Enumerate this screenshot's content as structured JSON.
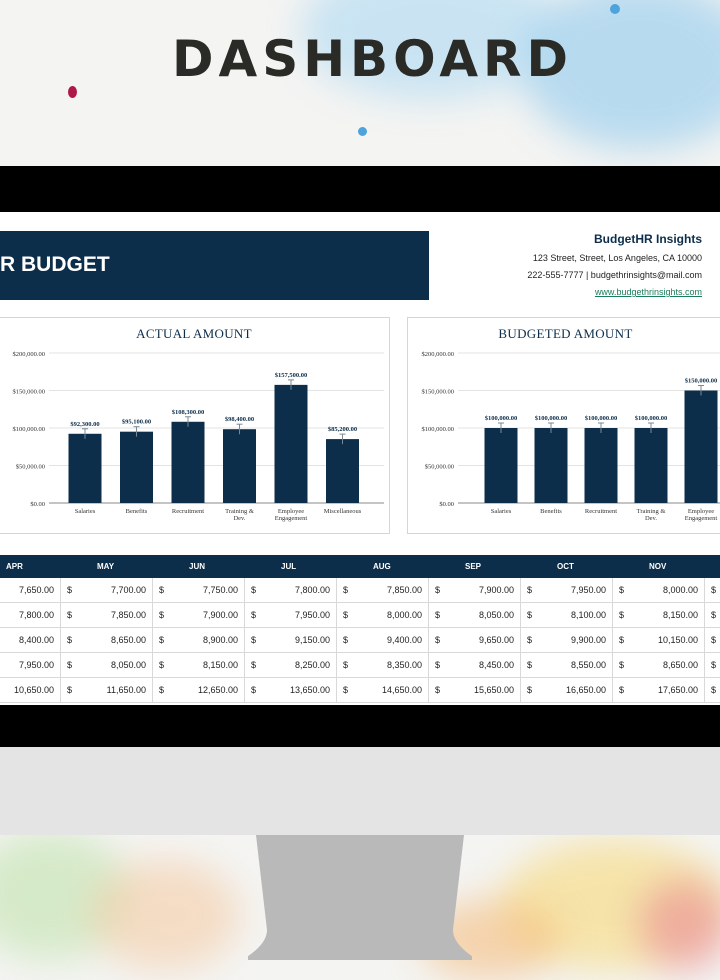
{
  "headline": "DASHBOARD",
  "header": {
    "title": "R BUDGET",
    "company_name": "BudgetHR Insights",
    "address": "123 Street, Street, Los Angeles, CA 10000",
    "contact": "222-555-7777  |  budgethrinsights@mail.com",
    "website": "www.budgethrinsights.com"
  },
  "colors": {
    "primary": "#0d2e4a",
    "link": "#1b7c5c"
  },
  "chart_data": [
    {
      "type": "bar",
      "title": "ACTUAL AMOUNT",
      "categories": [
        "Salaries",
        "Benefits",
        "Recruitment",
        "Training & Dev.",
        "Employee Engagement",
        "Miscellaneous"
      ],
      "values": [
        92300,
        95100,
        108300,
        98400,
        157500,
        85200
      ],
      "data_labels": [
        "$92,300.00",
        "$95,100.00",
        "$108,300.00",
        "$98,400.00",
        "$157,500.00",
        "$85,200.00"
      ],
      "yticks": [
        "$0.00",
        "$50,000.00",
        "$100,000.00",
        "$150,000.00",
        "$200,000.00"
      ],
      "ylim": [
        0,
        200000
      ],
      "error_bars": true,
      "grid": true
    },
    {
      "type": "bar",
      "title": "BUDGETED AMOUNT",
      "categories": [
        "Salaries",
        "Benefits",
        "Recruitment",
        "Training & Dev.",
        "Employee Engagement"
      ],
      "values": [
        100000,
        100000,
        100000,
        100000,
        150000
      ],
      "data_labels": [
        "$100,000.00",
        "$100,000.00",
        "$100,000.00",
        "$100,000.00",
        "$150,000.00"
      ],
      "yticks": [
        "$0.00",
        "$50,000.00",
        "$100,000.00",
        "$150,000.00",
        "$200,000.00"
      ],
      "ylim": [
        0,
        200000
      ],
      "error_bars": true,
      "grid": true
    }
  ],
  "table": {
    "currency": "$",
    "columns": [
      "APR",
      "MAY",
      "JUN",
      "JUL",
      "AUG",
      "SEP",
      "OCT",
      "NOV"
    ],
    "rows": [
      [
        "7,650.00",
        "7,700.00",
        "7,750.00",
        "7,800.00",
        "7,850.00",
        "7,900.00",
        "7,950.00",
        "8,000.00"
      ],
      [
        "7,800.00",
        "7,850.00",
        "7,900.00",
        "7,950.00",
        "8,000.00",
        "8,050.00",
        "8,100.00",
        "8,150.00"
      ],
      [
        "8,400.00",
        "8,650.00",
        "8,900.00",
        "9,150.00",
        "9,400.00",
        "9,650.00",
        "9,900.00",
        "10,150.00"
      ],
      [
        "7,950.00",
        "8,050.00",
        "8,150.00",
        "8,250.00",
        "8,350.00",
        "8,450.00",
        "8,550.00",
        "8,650.00"
      ],
      [
        "10,650.00",
        "11,650.00",
        "12,650.00",
        "13,650.00",
        "14,650.00",
        "15,650.00",
        "16,650.00",
        "17,650.00"
      ]
    ]
  }
}
